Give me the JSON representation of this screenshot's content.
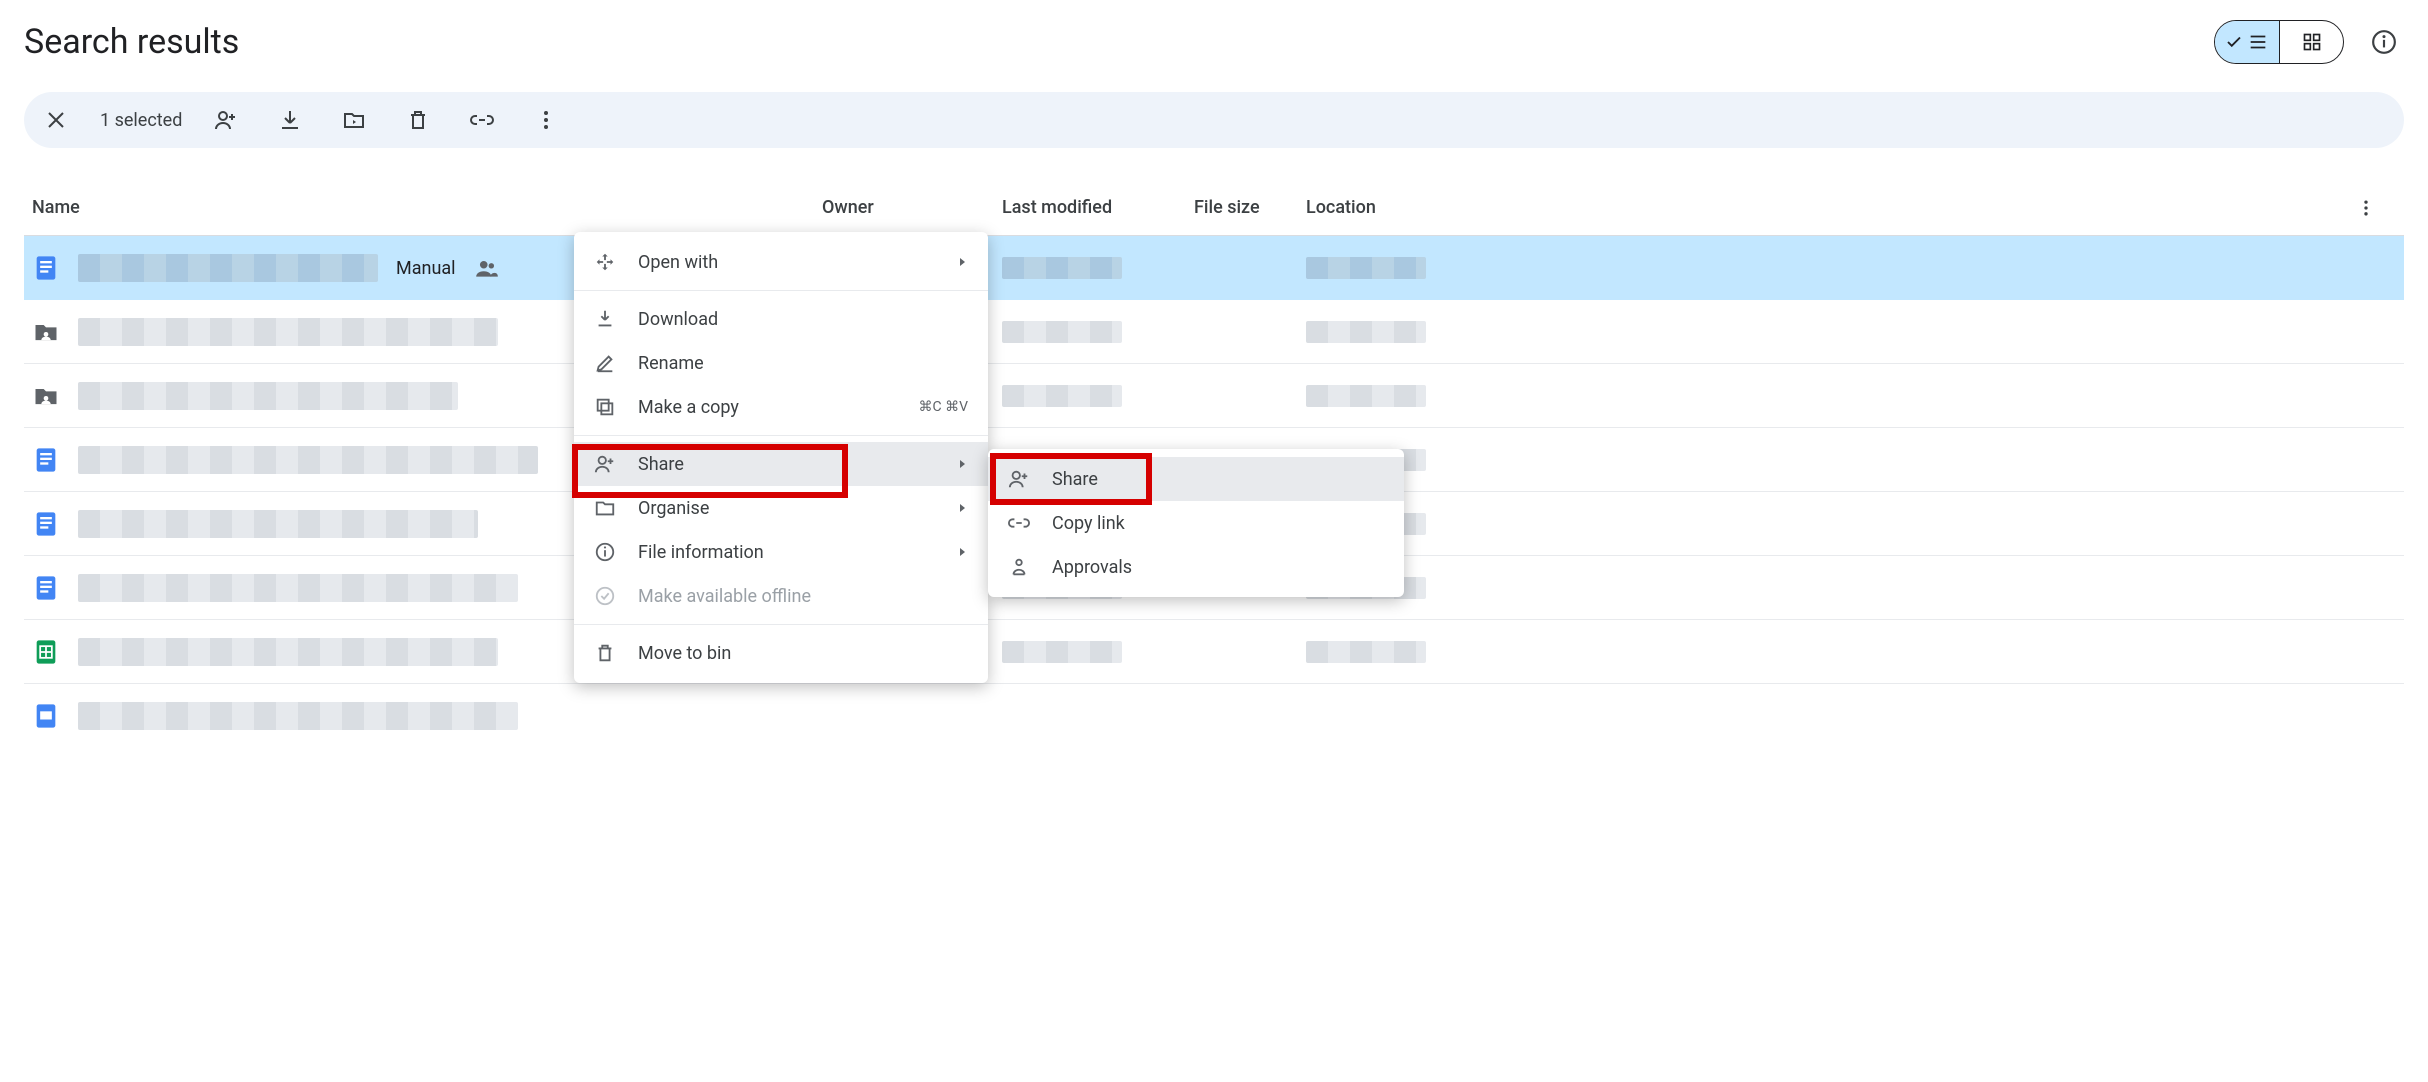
{
  "page_title": "Search results",
  "selection_bar": {
    "count_text": "1 selected"
  },
  "columns": {
    "name": "Name",
    "owner": "Owner",
    "last_modified": "Last modified",
    "file_size": "File size",
    "location": "Location"
  },
  "selected_file": {
    "label": "Manual"
  },
  "context_menu": {
    "open_with": "Open with",
    "download": "Download",
    "rename": "Rename",
    "make_copy": "Make a copy",
    "make_copy_shortcut": "⌘C ⌘V",
    "share": "Share",
    "organise": "Organise",
    "file_info": "File information",
    "offline": "Make available offline",
    "move_to_bin": "Move to bin"
  },
  "share_submenu": {
    "share": "Share",
    "copy_link": "Copy link",
    "approvals": "Approvals"
  },
  "row_types": [
    "doc-selected",
    "folder-shared",
    "folder-shared",
    "doc",
    "doc",
    "doc",
    "sheet",
    "slides"
  ]
}
